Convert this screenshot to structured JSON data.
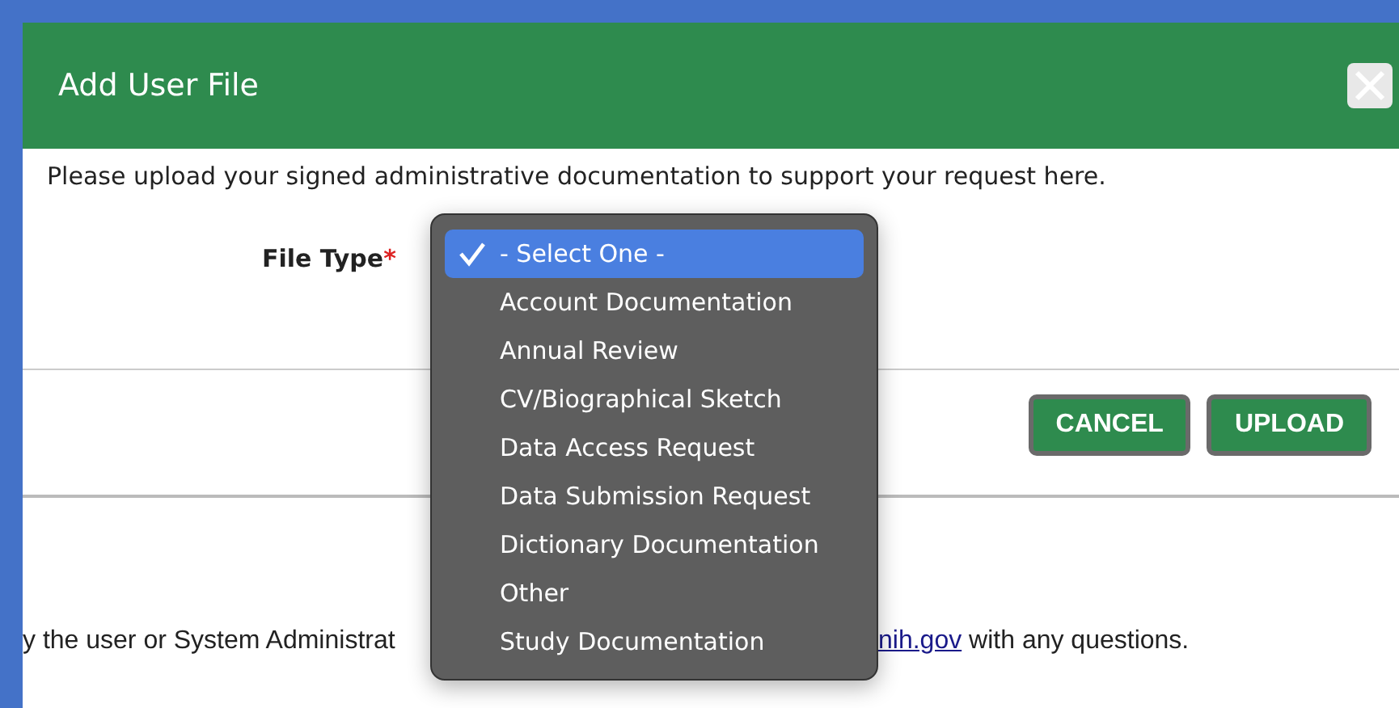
{
  "dialog": {
    "title": "Add User File",
    "instructions": "Please upload your signed administrative documentation to support your request here.",
    "field": {
      "label": "File Type",
      "required_mark": "*"
    },
    "buttons": [
      {
        "label": "CANCEL"
      },
      {
        "label": "UPLOAD"
      }
    ]
  },
  "dropdown": {
    "options": [
      {
        "label": "- Select One -",
        "selected": true
      },
      {
        "label": "Account Documentation",
        "selected": false
      },
      {
        "label": "Annual Review",
        "selected": false
      },
      {
        "label": "CV/Biographical Sketch",
        "selected": false
      },
      {
        "label": "Data Access Request",
        "selected": false
      },
      {
        "label": "Data Submission Request",
        "selected": false
      },
      {
        "label": "Dictionary Documentation",
        "selected": false
      },
      {
        "label": "Other",
        "selected": false
      },
      {
        "label": "Study Documentation",
        "selected": false
      }
    ]
  },
  "page_text": {
    "left": "y the user or System Administrat",
    "link": "nih.gov",
    "right": " with any questions."
  }
}
